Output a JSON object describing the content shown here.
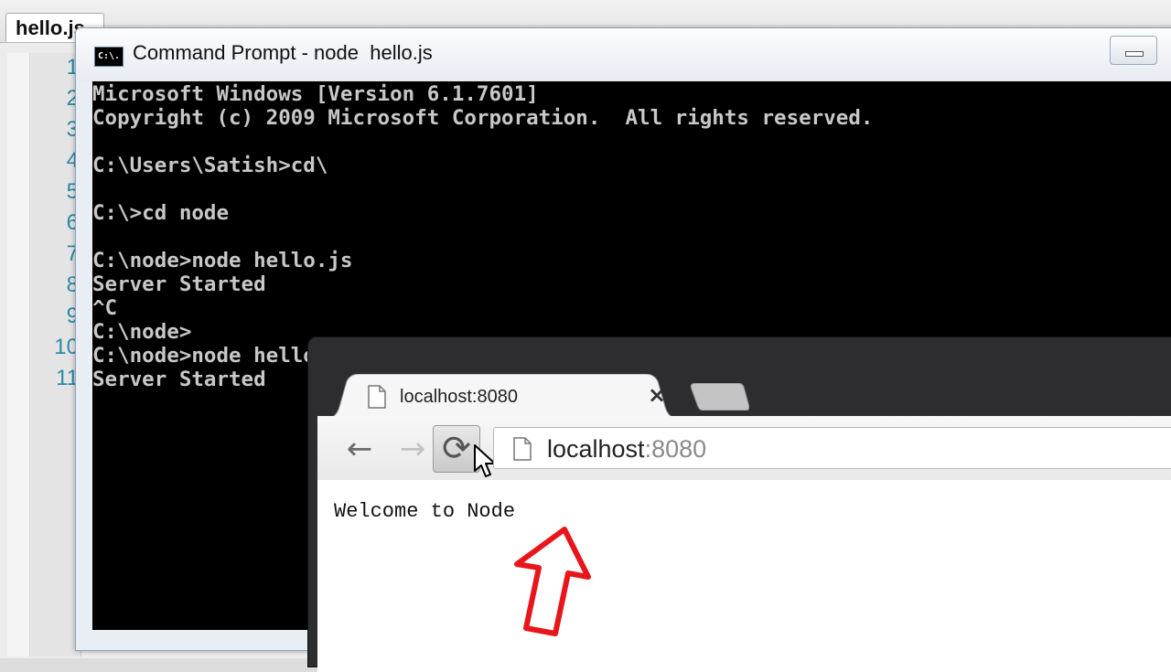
{
  "editor": {
    "tab_title": "hello.js",
    "line_numbers": [
      "1",
      "2",
      "3",
      "4",
      "5",
      "6",
      "7",
      "8",
      "9",
      "10",
      "11"
    ]
  },
  "cmd": {
    "title": "Command Prompt - node  hello.js",
    "icon_text": "C:\\.",
    "lines": [
      "Microsoft Windows [Version 6.1.7601]",
      "Copyright (c) 2009 Microsoft Corporation.  All rights reserved.",
      "",
      "C:\\Users\\Satish>cd\\",
      "",
      "C:\\>cd node",
      "",
      "C:\\node>node hello.js",
      "Server Started",
      "^C",
      "C:\\node>",
      "C:\\node>node hello.js",
      "Server Started"
    ]
  },
  "browser": {
    "tab_title": "localhost:8080",
    "tab_close": "×",
    "back": "←",
    "forward": "→",
    "reload": "⟳",
    "url_host": "localhost",
    "url_port": ":8080",
    "page_text": "Welcome to Node"
  },
  "colors": {
    "console_bg": "#000000",
    "console_text": "#c8c8c8",
    "arrow": "#e8151b",
    "line_number": "#2a8aa6"
  }
}
